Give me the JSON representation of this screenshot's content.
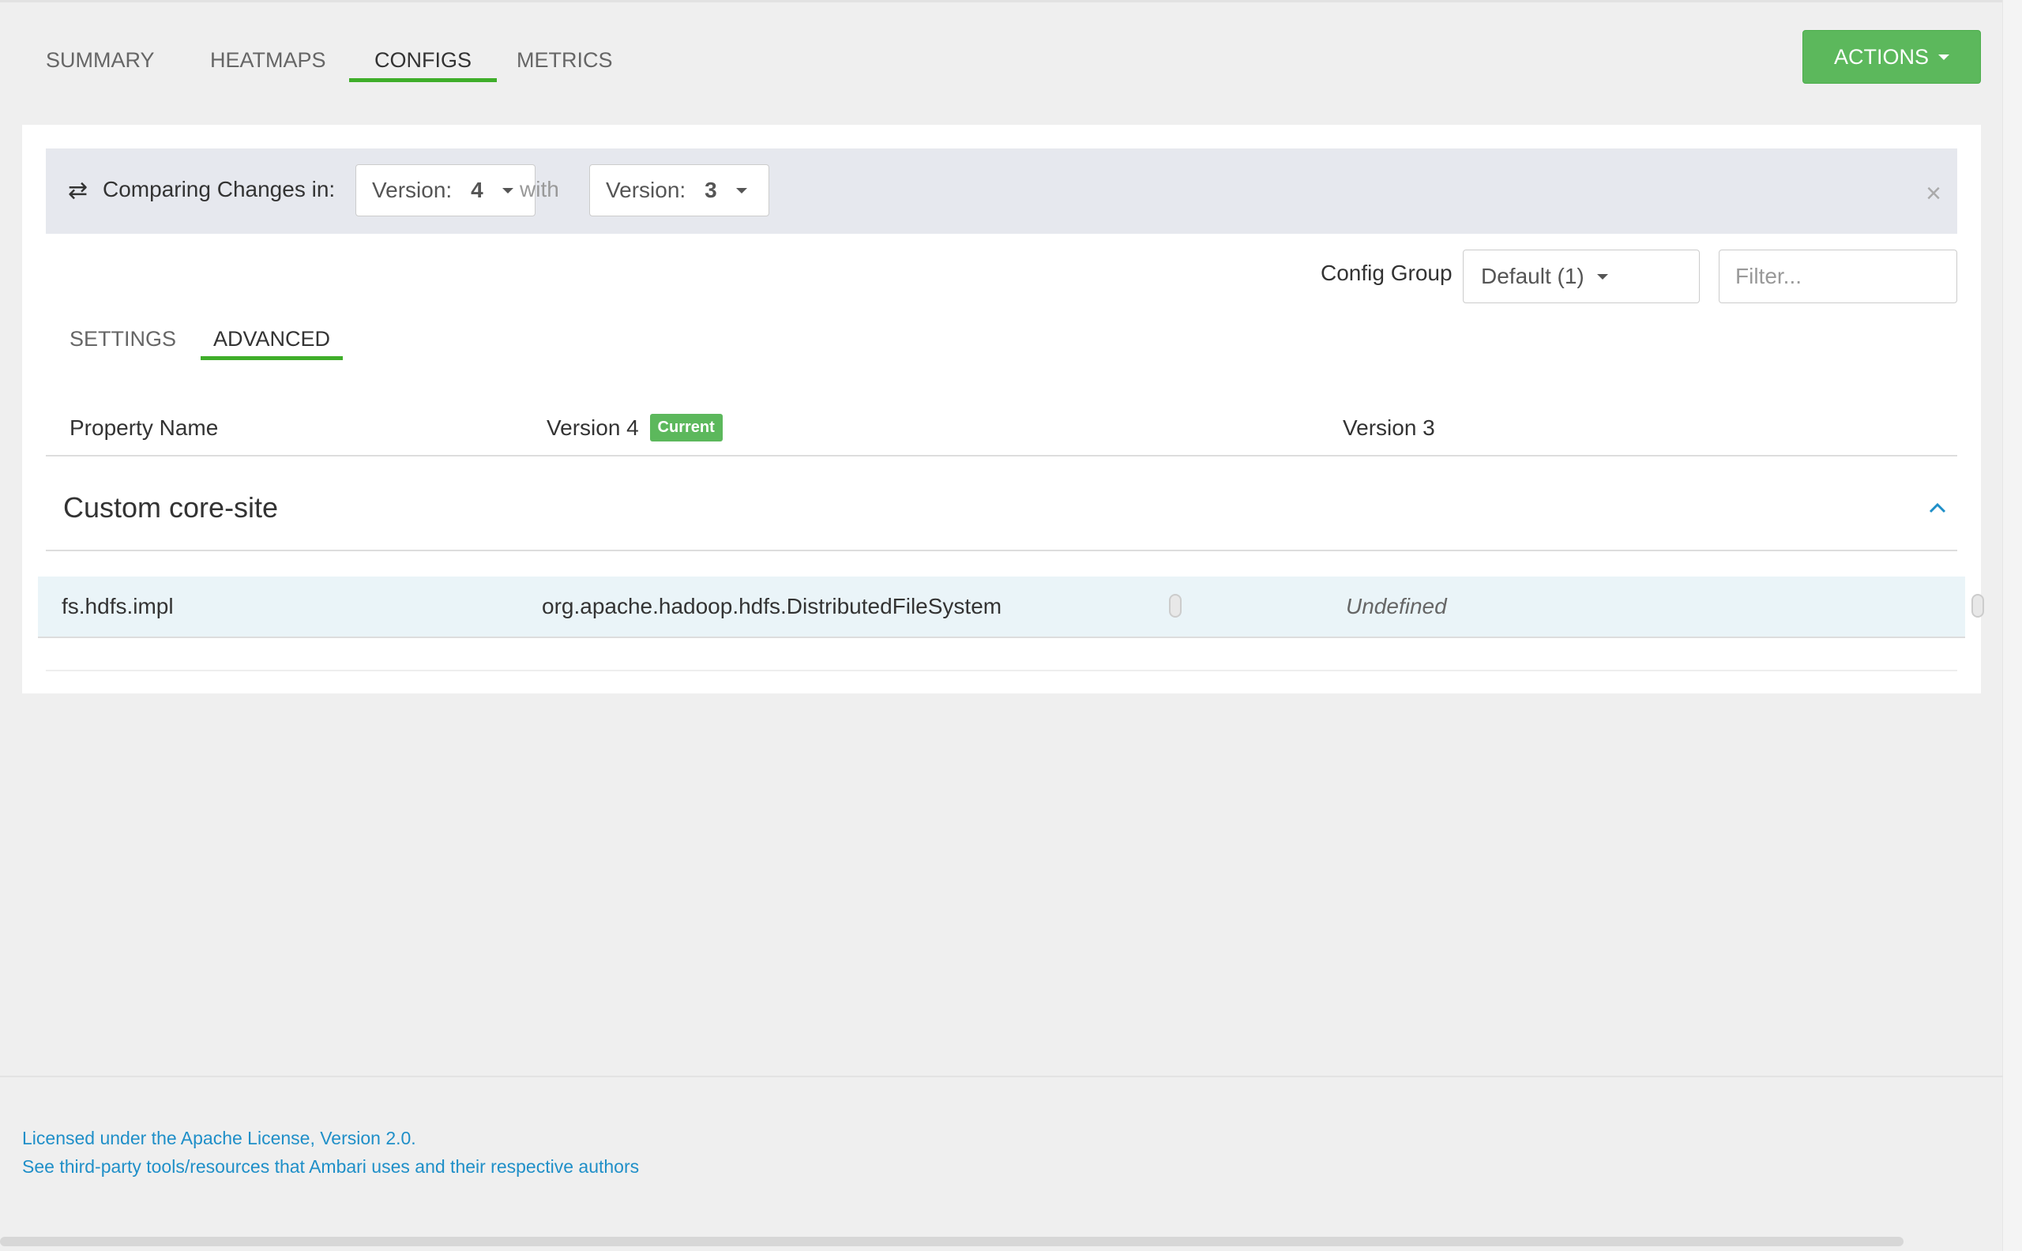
{
  "service_tabs": [
    "SUMMARY",
    "HEATMAPS",
    "CONFIGS",
    "METRICS"
  ],
  "actions": {
    "label": "ACTIONS"
  },
  "compare": {
    "label": "Comparing Changes in:",
    "left_version_label": "Version:",
    "left_version_value": "4",
    "with_label": "with",
    "right_version_label": "Version:",
    "right_version_value": "3",
    "close_symbol": "×"
  },
  "config_group": {
    "label": "Config Group",
    "value": "Default (1)"
  },
  "filter": {
    "placeholder": "Filter..."
  },
  "sub_tabs": [
    "SETTINGS",
    "ADVANCED"
  ],
  "columns": {
    "property_name": "Property Name",
    "version_a": "Version 4",
    "current_badge": "Current",
    "version_b": "Version 3"
  },
  "section": {
    "title": "Custom core-site"
  },
  "rows": [
    {
      "name": "fs.hdfs.impl",
      "value_a": "org.apache.hadoop.hdfs.DistributedFileSystem",
      "value_b": "Undefined"
    }
  ],
  "footer": {
    "license": "Licensed under the Apache License, Version 2.0.",
    "third_party": "See third-party tools/resources that Ambari uses and their respective authors"
  },
  "colors": {
    "accent_green": "#5cb85c",
    "tab_underline": "#3fae2a",
    "link_blue": "#1f8fc8"
  },
  "icons": [
    "exchange-icon",
    "caret-down-icon",
    "close-icon",
    "chevron-up-icon"
  ]
}
